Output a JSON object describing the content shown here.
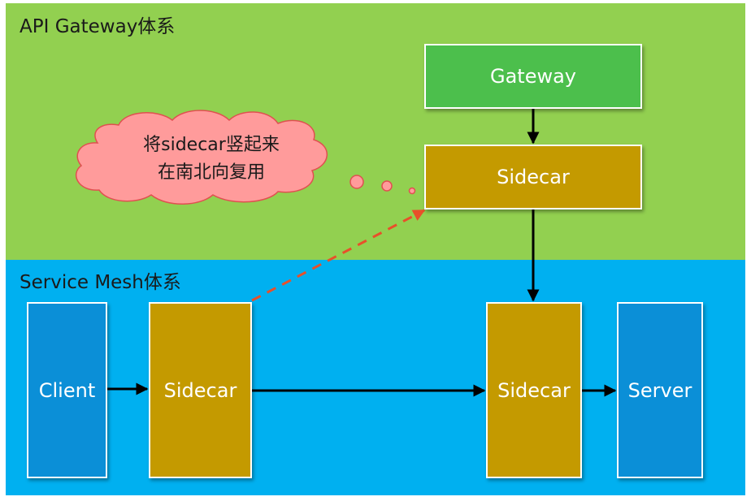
{
  "regions": {
    "api_gateway": {
      "title": "API Gateway体系",
      "color": "#92d050"
    },
    "service_mesh": {
      "title": "Service Mesh体系",
      "color": "#00b0f0"
    }
  },
  "nodes": {
    "gateway": {
      "label": "Gateway",
      "color": "#4cbf4c"
    },
    "gateway_sidecar": {
      "label": "Sidecar",
      "color": "#c49a00"
    },
    "client": {
      "label": "Client",
      "color": "#0b8fd7"
    },
    "client_sidecar": {
      "label": "Sidecar",
      "color": "#c49a00"
    },
    "server_sidecar": {
      "label": "Sidecar",
      "color": "#c49a00"
    },
    "server": {
      "label": "Server",
      "color": "#0b8fd7"
    }
  },
  "annotation": {
    "line1": "将sidecar竖起来",
    "line2": "在南北向复用",
    "fill": "#ff9b9b",
    "stroke": "#e05050"
  },
  "arrow_colors": {
    "solid": "#000000",
    "dashed": "#e8502a"
  }
}
